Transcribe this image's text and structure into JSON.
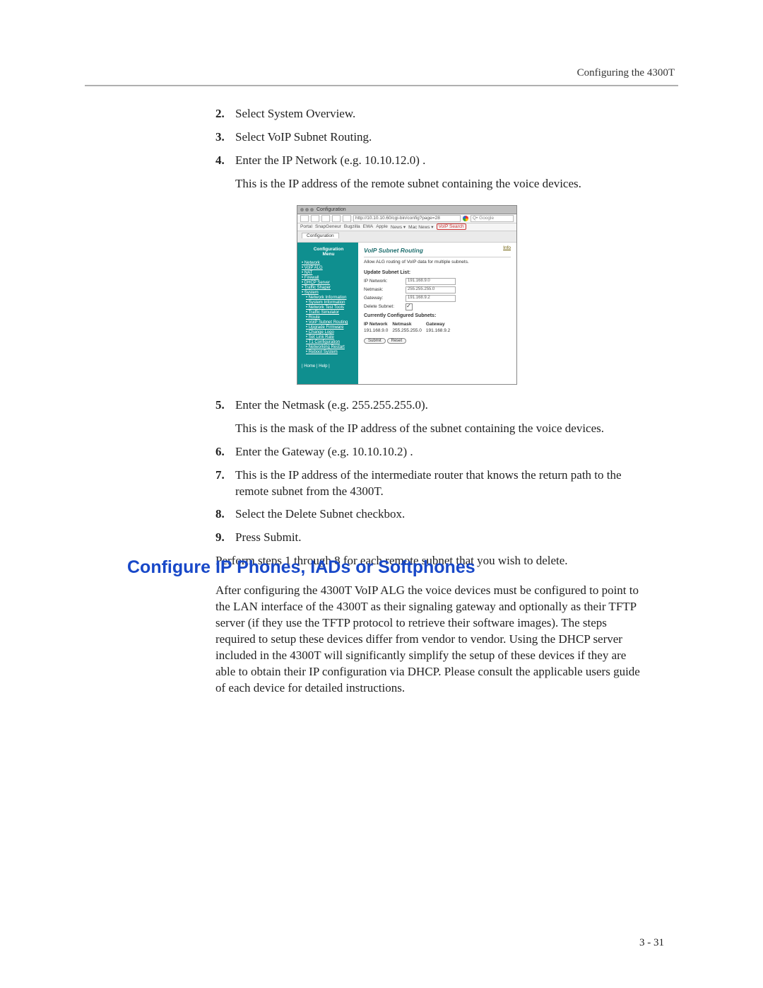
{
  "running_head": "Configuring the 4300T",
  "page_number": "3 - 31",
  "steps_a": [
    {
      "n": "2.",
      "t": "Select System Overview."
    },
    {
      "n": "3.",
      "t": "Select VoIP Subnet Routing."
    },
    {
      "n": "4.",
      "t": "Enter the IP Network (e.g. 10.10.12.0) ."
    }
  ],
  "para4": "This is the IP address of the remote subnet containing the voice devices.",
  "steps_b": [
    {
      "n": "5.",
      "t": "Enter the Netmask (e.g. 255.255.255.0)."
    }
  ],
  "para5": "This is the mask of the IP address of the subnet containing the voice devices.",
  "steps_c": [
    {
      "n": "6.",
      "t": "Enter the Gateway (e.g. 10.10.10.2) ."
    },
    {
      "n": "7.",
      "t": "This is the IP address of the intermediate router that knows the return path to the remote subnet from the 4300T."
    },
    {
      "n": "8.",
      "t": "Select the Delete Subnet checkbox."
    },
    {
      "n": "9.",
      "t": "Press Submit."
    }
  ],
  "para_end": "Perform steps 1 through 8 for each remote subnet that you wish to delete.",
  "heading": "Configure IP Phones, IADs or Softphones",
  "body_after": "After configuring the 4300T VoIP ALG the voice devices must be configured to point to the LAN interface of the 4300T as their signaling gateway and optionally as their TFTP server (if they use the TFTP protocol to retrieve their software images).  The steps required to setup these devices differ from vendor to vendor.  Using the DHCP server included in the 4300T will significantly simplify the setup of these devices if they are able to obtain their IP configuration via DHCP.  Please consult the applicable users guide of each device for detailed instructions.",
  "shot": {
    "title": "Configuration",
    "url": "http://10.10.10.60/cgi-bin/config?page=28",
    "search_ph": "Q• Google",
    "bookmarks": [
      "Portal",
      "SnapGeneur",
      "Bugzilla",
      "EWA",
      "Apple",
      "News ▾",
      "Mac News ▾"
    ],
    "bm_tag": "VoIP Search",
    "tab": "Configuration",
    "side_title1": "Configuration",
    "side_title2": "Menu",
    "side_links_top": [
      "Network",
      "VoIP ALG",
      "NAT",
      "Firewall",
      "DHCP Server",
      "Traffic Shaper",
      "System"
    ],
    "side_links_sub": [
      "Network Information",
      "System Information",
      "Network Test Tools",
      "Traffic Simulator",
      "Route",
      "VoIP Subnet Routing",
      "Upgrade Firmware",
      "Change Logo",
      "Set Link Rate",
      "T1 Configuration",
      "Networking Restart",
      "Reboot System"
    ],
    "side_foot": "| Home | Help |",
    "main_title": "VoIP Subnet Routing",
    "info": "Info",
    "desc": "Allow ALG routing of VoIP data for multiple subnets.",
    "sect_update": "Update Subnet List:",
    "f_ip_label": "IP Network:",
    "f_ip_val": "191.168.9.0",
    "f_nm_label": "Netmask:",
    "f_nm_val": "255.255.255.0",
    "f_gw_label": "Gateway:",
    "f_gw_val": "191.168.9.2",
    "f_del_label": "Delete Subnet:",
    "sect_cur": "Currently Configured Subnets:",
    "tbl_h1": "IP Network",
    "tbl_h2": "Netmask",
    "tbl_h3": "Gateway",
    "tbl_r1c1": "191.168.9.0",
    "tbl_r1c2": "255.255.255.0",
    "tbl_r1c3": "191.168.9.2",
    "btn_submit": "Submit",
    "btn_reset": "Reset"
  }
}
